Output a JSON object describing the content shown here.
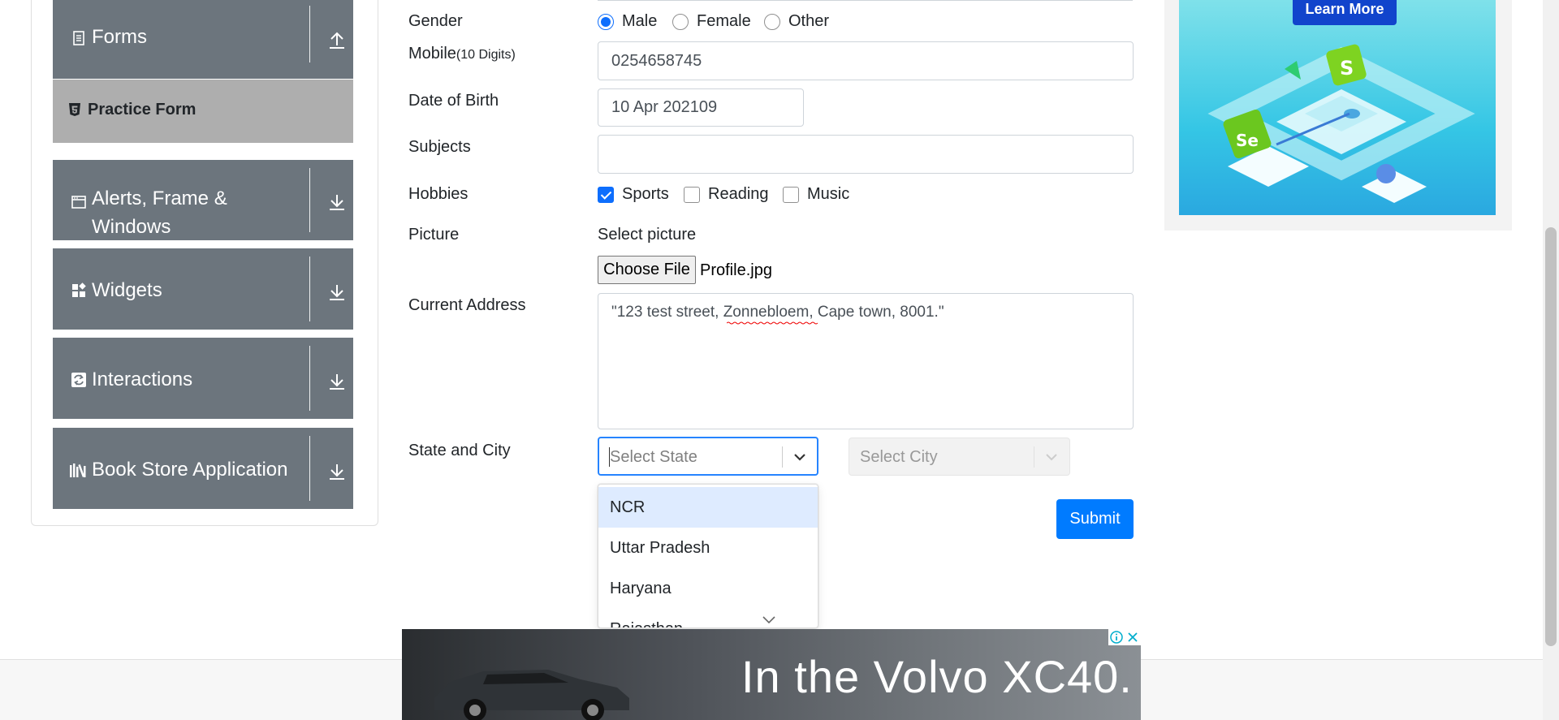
{
  "sidebar": {
    "groups": [
      {
        "label": "Forms",
        "icon": "form-icon",
        "toggle": "collapse-arrow-icon"
      },
      {
        "label": "Alerts, Frame & Windows",
        "icon": "window-icon",
        "toggle": "expand-arrow-icon"
      },
      {
        "label": "Widgets",
        "icon": "widgets-icon",
        "toggle": "expand-arrow-icon"
      },
      {
        "label": "Interactions",
        "icon": "interactions-icon",
        "toggle": "expand-arrow-icon"
      },
      {
        "label": "Book Store Application",
        "icon": "books-icon",
        "toggle": "expand-arrow-icon"
      }
    ],
    "active_item": {
      "label": "Practice Form",
      "icon": "html5-icon"
    },
    "colors": {
      "group_bg": "#6c757d",
      "active_bg": "#aeaeae"
    }
  },
  "form": {
    "gender": {
      "label": "Gender",
      "options": [
        "Male",
        "Female",
        "Other"
      ],
      "selected": "Male"
    },
    "mobile": {
      "label": "Mobile",
      "hint": "(10 Digits)",
      "value": "0254658745"
    },
    "dob": {
      "label": "Date of Birth",
      "value": "10 Apr 202109"
    },
    "subjects": {
      "label": "Subjects",
      "value": ""
    },
    "hobbies": {
      "label": "Hobbies",
      "options": [
        "Sports",
        "Reading",
        "Music"
      ],
      "checked": [
        "Sports"
      ]
    },
    "picture": {
      "label": "Picture",
      "caption": "Select picture",
      "button": "Choose File",
      "file": "Profile.jpg"
    },
    "address": {
      "label": "Current Address",
      "value": "\"123 test street, Zonnebloem, Cape town, 8001.\""
    },
    "state_city": {
      "label": "State and City",
      "state_placeholder": "Select State",
      "city_placeholder": "Select City",
      "state_options": [
        "NCR",
        "Uttar Pradesh",
        "Haryana",
        "Rajasthan"
      ],
      "highlighted": "NCR"
    },
    "submit": "Submit",
    "colors": {
      "primary": "#007bff",
      "focus_border": "#2684ff",
      "highlight": "#deebff"
    }
  },
  "ads": {
    "side": {
      "button": "Learn More",
      "badge_s": "S",
      "badge_se": "Se"
    },
    "bottom": {
      "text": "In the Volvo XC40.",
      "info_icon": "info-icon",
      "close_icon": "close-icon"
    }
  }
}
